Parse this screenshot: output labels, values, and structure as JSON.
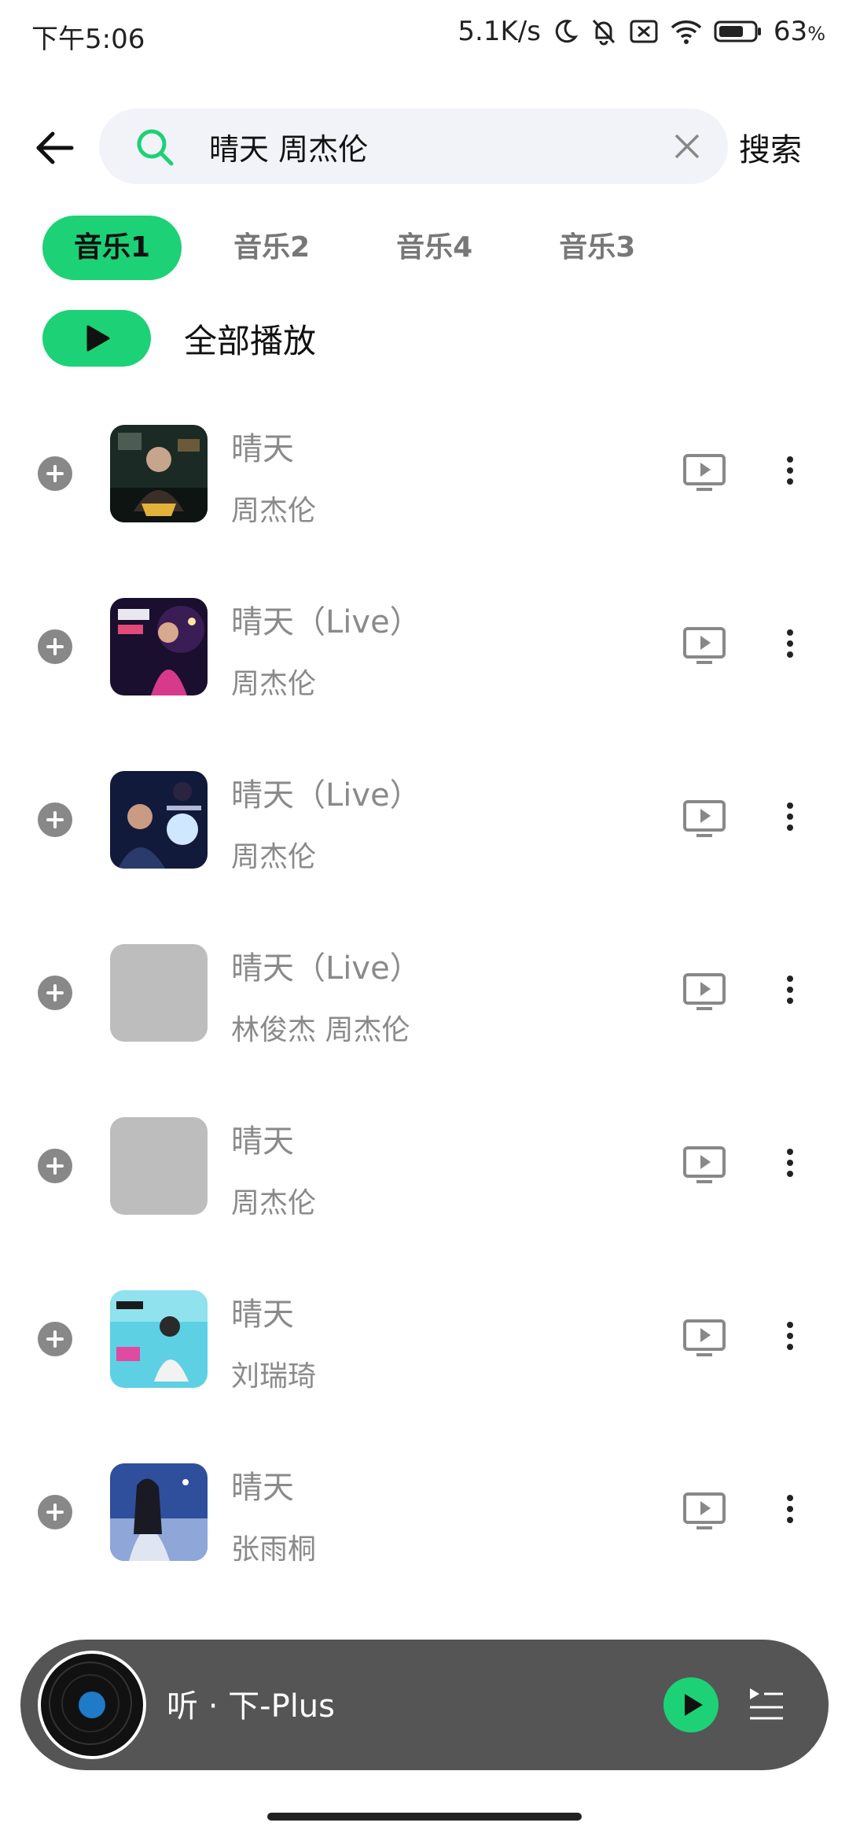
{
  "status_bar": {
    "time": "下午5:06",
    "network_speed": "5.1K/s",
    "battery_percent": "63",
    "battery_unit": "%",
    "icons": [
      "moon-icon",
      "bell-off-icon",
      "sim-off-icon",
      "wifi-icon",
      "battery-icon"
    ]
  },
  "search": {
    "query": "晴天 周杰伦",
    "button_label": "搜索",
    "accent_color": "#1dd176"
  },
  "tabs": [
    {
      "label": "音乐1",
      "active": true
    },
    {
      "label": "音乐2",
      "active": false
    },
    {
      "label": "音乐4",
      "active": false
    },
    {
      "label": "音乐3",
      "active": false
    }
  ],
  "play_all": {
    "label": "全部播放"
  },
  "songs": [
    {
      "title": "晴天",
      "artist": "周杰伦",
      "cover": "album-art-dark"
    },
    {
      "title": "晴天（Live）",
      "artist": "周杰伦",
      "cover": "album-art-concert-pink"
    },
    {
      "title": "晴天（Live）",
      "artist": "周杰伦",
      "cover": "album-art-concert-blue"
    },
    {
      "title": "晴天（Live）",
      "artist": "林俊杰 周杰伦",
      "cover": "placeholder"
    },
    {
      "title": "晴天",
      "artist": "周杰伦",
      "cover": "placeholder"
    },
    {
      "title": "晴天",
      "artist": "刘瑞琦",
      "cover": "album-art-teal"
    },
    {
      "title": "晴天",
      "artist": "张雨桐",
      "cover": "album-art-blue-night"
    }
  ],
  "mini_player": {
    "title": "听 · 下-Plus"
  }
}
